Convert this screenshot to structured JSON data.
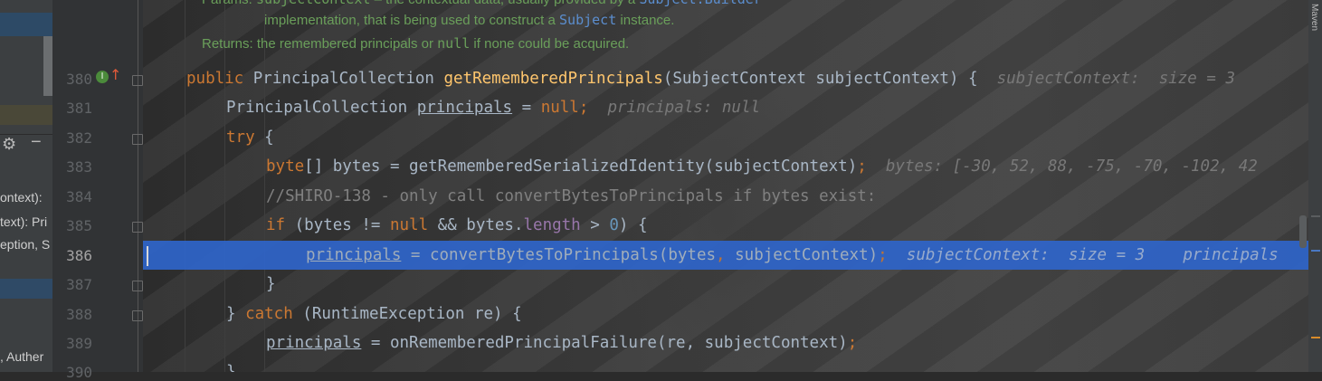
{
  "side_panel": {
    "fragments": [
      "ontext):",
      "text): Pri",
      "eption, S",
      ", Auther"
    ]
  },
  "gutter": {
    "line_numbers": [
      "380",
      "381",
      "382",
      "383",
      "384",
      "385",
      "386",
      "387",
      "388",
      "389",
      "390"
    ]
  },
  "javadoc": {
    "params_label": "Params:",
    "params_code": "subjectContext",
    "params_text": " – the contextual data, usually provided by a ",
    "params_link": "Subject.Builder",
    "params_line2_a": "implementation, that is being used to construct a ",
    "params_line2_link": "Subject",
    "params_line2_b": " instance.",
    "returns_label": "Returns:",
    "returns_text_a": "the remembered principals or ",
    "returns_code": "null",
    "returns_text_b": " if none could be acquired."
  },
  "code": {
    "l380": {
      "kw": "public ",
      "type": "PrincipalCollection ",
      "fn": "getRememberedPrincipals",
      "rest": "(SubjectContext subjectContext) {",
      "hint": "subjectContext:  size = 3"
    },
    "l381": {
      "a": "PrincipalCollection ",
      "var": "principals",
      "b": " = ",
      "kw": "null",
      "c": ";",
      "hint": "principals: null"
    },
    "l382": {
      "kw": "try",
      "rest": " {"
    },
    "l383": {
      "kw": "byte",
      "a": "[] bytes = getRememberedSerializedIdentity(subjectContext)",
      "semi": ";",
      "hint": "bytes: [-30, 52, 88, -75, -70, -102, 42"
    },
    "l384": {
      "comment": "//SHIRO-138 - only call convertBytesToPrincipals if bytes exist:"
    },
    "l385": {
      "kw": "if",
      "a": " (bytes != ",
      "kw2": "null",
      "b": " && bytes.",
      "field": "length",
      "c": " > ",
      "num": "0",
      "d": ") {"
    },
    "l386": {
      "var": "principals",
      "a": " = convertBytesToPrincipals(bytes",
      "comma": ",",
      "b": " subjectContext)",
      "semi": ";",
      "hint": "subjectContext:  size = 3    principals"
    },
    "l387": {
      "a": "}"
    },
    "l388": {
      "a": "} ",
      "kw": "catch",
      "b": " (RuntimeException re) {"
    },
    "l389": {
      "var": "principals",
      "a": " = onRememberedPrincipalFailure(re, subjectContext)",
      "semi": ";"
    },
    "l390": {
      "a": "}"
    }
  },
  "right_strip": {
    "label": "Maven"
  },
  "colors": {
    "keyword": "#cc7832",
    "method": "#ffc66d",
    "number": "#6897bb",
    "field": "#9876aa",
    "comment": "#808080",
    "selection": "#2f65ca"
  },
  "icons": [
    "gear-icon",
    "minus-icon",
    "override-icon",
    "fold-icon"
  ]
}
